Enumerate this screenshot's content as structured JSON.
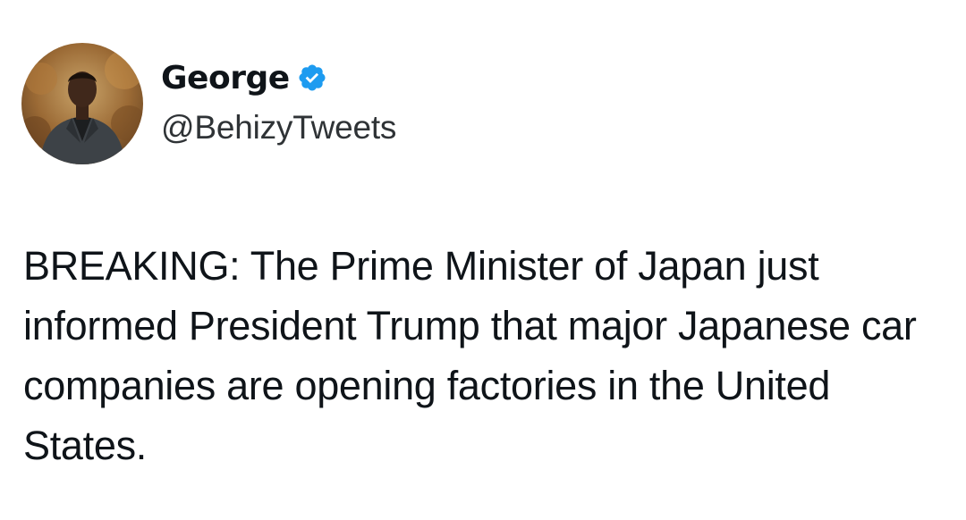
{
  "author": {
    "display_name": "George",
    "handle": "@BehizyTweets",
    "verified": true,
    "verified_color": "#1d9bf0",
    "avatar_icon": "profile-photo"
  },
  "tweet": {
    "text": "BREAKING: The Prime Minister of Japan just informed President Trump that major Japanese car companies are opening factories in the United States."
  }
}
